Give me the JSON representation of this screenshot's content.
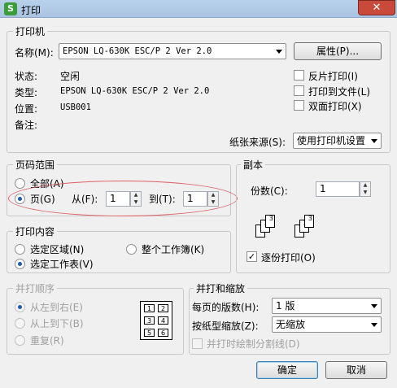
{
  "window": {
    "title": "打印",
    "app_icon_letter": "S",
    "close_symbol": "✕"
  },
  "printer": {
    "legend": "打印机",
    "name_label": "名称(M):",
    "name_value": "EPSON LQ-630K ESC/P 2 Ver 2.0",
    "properties_button": "属性(P)...",
    "status_label": "状态:",
    "status_value": "空闲",
    "type_label": "类型:",
    "type_value": "EPSON LQ-630K ESC/P 2 Ver 2.0",
    "location_label": "位置:",
    "location_value": "USB001",
    "comment_label": "备注:",
    "reverse_print": {
      "label": "反片打印(I)",
      "checked": false
    },
    "print_to_file": {
      "label": "打印到文件(L)",
      "checked": false
    },
    "duplex": {
      "label": "双面打印(X)",
      "checked": false
    },
    "paper_source_label": "纸张来源(S):",
    "paper_source_value": "使用打印机设置"
  },
  "page_range": {
    "legend": "页码范围",
    "all_label": "全部(A)",
    "pages_label": "页(G)",
    "from_label": "从(F):",
    "from_value": "1",
    "to_label": "到(T):",
    "to_value": "1",
    "selected": "pages"
  },
  "copies": {
    "legend": "副本",
    "count_label": "份数(C):",
    "count_value": "1",
    "collate": {
      "label": "逐份打印(O)",
      "checked": true,
      "check_mark": "✓"
    },
    "collate_page_labels": [
      "1",
      "2",
      "3",
      "1",
      "2",
      "3"
    ]
  },
  "print_content": {
    "legend": "打印内容",
    "selection_label": "选定区域(N)",
    "workbook_label": "整个工作簿(K)",
    "sheet_label": "选定工作表(V)",
    "selected": "sheet"
  },
  "print_order": {
    "legend": "并打顺序",
    "left_to_right": "从左到右(E)",
    "top_to_bottom": "从上到下(B)",
    "repeat": "重复(R)",
    "grid_numbers": [
      "1",
      "2",
      "3",
      "4",
      "5",
      "6"
    ]
  },
  "scaling": {
    "legend": "并打和缩放",
    "pages_per_sheet_label": "每页的版数(H):",
    "pages_per_sheet_value": "1 版",
    "scale_label": "按纸型缩放(Z):",
    "scale_value": "无缩放",
    "draw_border_label": "并打时绘制分割线(D)"
  },
  "buttons": {
    "ok": "确定",
    "cancel": "取消"
  },
  "colors": {
    "highlight_ellipse": "#e06060",
    "titlebar": "#b9d1ea",
    "close": "#c94a3a"
  }
}
